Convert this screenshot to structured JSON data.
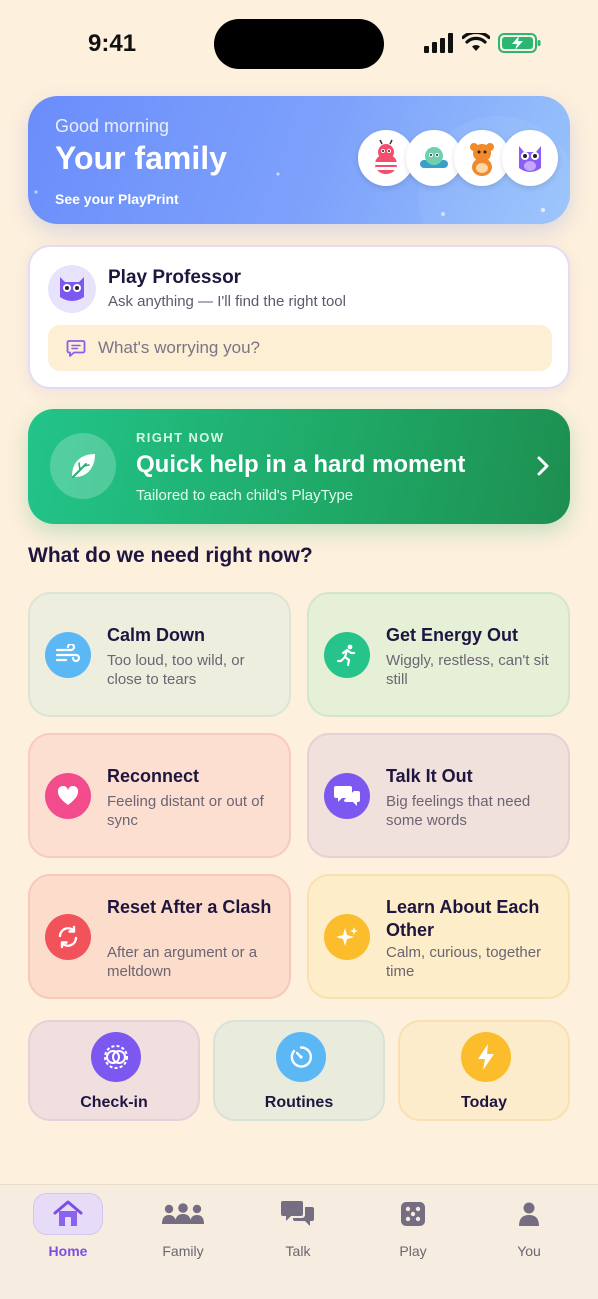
{
  "status_bar": {
    "time": "9:41"
  },
  "hero": {
    "greeting": "Good morning",
    "title": "Your family",
    "link": "See your PlayPrint",
    "avatars": [
      "bee-character-icon",
      "snail-character-icon",
      "bear-character-icon",
      "owl-character-icon"
    ]
  },
  "professor": {
    "title": "Play Professor",
    "subtitle": "Ask anything — I'll find the right tool",
    "input_placeholder": "What's worrying you?"
  },
  "quick_help": {
    "eyebrow": "RIGHT NOW",
    "title": "Quick help in a hard moment",
    "subtitle": "Tailored to each child's PlayType"
  },
  "section_title": "What do we need right now?",
  "cards": [
    {
      "title": "Calm Down",
      "subtitle": "Too loud, too wild, or close to tears",
      "icon": "wind-icon",
      "accent": "#5bb8f5"
    },
    {
      "title": "Get Energy Out",
      "subtitle": "Wiggly, restless, can't sit still",
      "icon": "running-person-icon",
      "accent": "#26c48a"
    },
    {
      "title": "Reconnect",
      "subtitle": "Feeling distant or out of sync",
      "icon": "heart-icon",
      "accent": "#f24c8c"
    },
    {
      "title": "Talk It Out",
      "subtitle": "Big feelings that need some words",
      "icon": "chat-bubbles-icon",
      "accent": "#7c58f0"
    },
    {
      "title": "Reset After a Clash",
      "subtitle": "After an argument or a meltdown",
      "icon": "refresh-icon",
      "accent": "#f2535a"
    },
    {
      "title": "Learn About Each Other",
      "subtitle": "Calm, curious, together time",
      "icon": "sparkles-icon",
      "accent": "#fbbd2c"
    }
  ],
  "tiles": [
    {
      "label": "Check-in",
      "icon": "check-in-icon",
      "accent": "#7c58f0"
    },
    {
      "label": "Routines",
      "icon": "timer-icon",
      "accent": "#5bb8f5"
    },
    {
      "label": "Today",
      "icon": "lightning-icon",
      "accent": "#fbbd2c"
    }
  ],
  "tabbar": {
    "tabs": [
      {
        "label": "Home",
        "icon": "home-icon",
        "active": true
      },
      {
        "label": "Family",
        "icon": "family-icon",
        "active": false
      },
      {
        "label": "Talk",
        "icon": "chat-icon",
        "active": false
      },
      {
        "label": "Play",
        "icon": "dice-icon",
        "active": false
      },
      {
        "label": "You",
        "icon": "person-icon",
        "active": false
      }
    ]
  }
}
